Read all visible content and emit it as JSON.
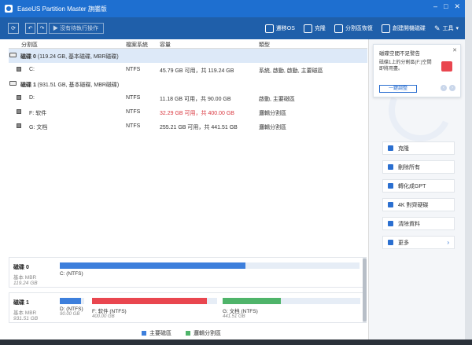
{
  "app": {
    "title": "EaseUS Partition Master 旗艦版"
  },
  "window": {
    "minimize": "–",
    "maximize": "□",
    "close": "✕"
  },
  "toolbar": {
    "pending_label": "▶ 沒有待執行操作",
    "actions": [
      {
        "label": "遷移OS",
        "icon": "migrate-os-icon"
      },
      {
        "label": "克隆",
        "icon": "clone-icon"
      },
      {
        "label": "分割區恢復",
        "icon": "partition-recovery-icon"
      },
      {
        "label": "創建開機磁碟",
        "icon": "bootable-disk-icon"
      },
      {
        "label": "工具",
        "icon": "tools-icon"
      }
    ]
  },
  "columns": {
    "partition": "分割區",
    "filesystem": "檔案系統",
    "capacity": "容量",
    "type": "類型"
  },
  "rows": [
    {
      "kind": "disk",
      "name": "磁碟 0",
      "info": "(119.24 GB, 基本磁碟, MBR磁碟)",
      "fs": "",
      "cap": "",
      "type": ""
    },
    {
      "kind": "part",
      "name": "C:",
      "info": "",
      "fs": "NTFS",
      "cap": "45.79 GB  可用，共  119.24 GB",
      "type": "系統, 啟動, 啟動, 主要磁區"
    },
    {
      "kind": "disk",
      "name": "磁碟 1",
      "info": "(931.51 GB, 基本磁碟, MBR磁碟)",
      "fs": "",
      "cap": "",
      "type": ""
    },
    {
      "kind": "part",
      "name": "D:",
      "info": "",
      "fs": "NTFS",
      "cap": "11.18 GB  可用，共  90.00 GB",
      "type": "啟動, 主要磁區"
    },
    {
      "kind": "part",
      "name": "F: 软件",
      "info": "",
      "fs": "NTFS",
      "cap": "32.29 GB  可用，共  400.00 GB",
      "type": "邏輯分割區"
    },
    {
      "kind": "part",
      "name": "G: 文档",
      "info": "",
      "fs": "NTFS",
      "cap": "255.21 GB  可用，共  441.51 GB",
      "type": "邏輯分割區"
    }
  ],
  "notice": {
    "title": "磁碟空間不足警告",
    "body": "磁碟1上的分割區(F:)空間即將用盡。",
    "button": "一鍵調整",
    "close": "✕"
  },
  "operations": [
    {
      "label": "克隆",
      "icon": "clone-icon"
    },
    {
      "label": "刪除所有",
      "icon": "delete-icon"
    },
    {
      "label": "轉化成GPT",
      "icon": "convert-gpt-icon"
    },
    {
      "label": "4K 對齊硬碟",
      "icon": "align-4k-icon"
    },
    {
      "label": "清除資料",
      "icon": "wipe-icon"
    },
    {
      "label": "更多",
      "icon": "more-icon"
    }
  ],
  "map": {
    "disk0": {
      "name": "磁碟 0",
      "type": "基本 MBR",
      "size": "119.24 GB",
      "parts": [
        {
          "name": "C: (NTFS)",
          "size": "",
          "used_fraction": 0.62,
          "color": "#3d7fdc"
        }
      ]
    },
    "disk1": {
      "name": "磁碟 1",
      "type": "基本 MBR",
      "size": "931.51 GB",
      "parts": [
        {
          "name": "D: (NTFS)",
          "size": "90.00 GB",
          "used_fraction": 0.88,
          "color": "#3d7fdc"
        },
        {
          "name": "F: 软件 (NTFS)",
          "size": "400.00 GB",
          "used_fraction": 0.92,
          "color": "#e9464f"
        },
        {
          "name": "G: 文档 (NTFS)",
          "size": "441.51 GB",
          "used_fraction": 0.42,
          "color": "#4fb46a"
        }
      ]
    }
  },
  "legend": [
    {
      "label": "主要磁區",
      "color": "#3d7fdc"
    },
    {
      "label": "邏輯分割區",
      "color": "#4fb46a"
    }
  ]
}
